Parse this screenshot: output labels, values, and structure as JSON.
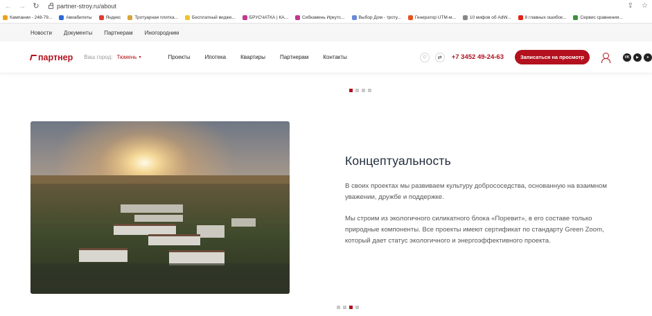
{
  "browser": {
    "url": "partner-stroy.ru/about",
    "bookmarks": [
      {
        "label": "Кампании - 248-79...",
        "color": "#e8a31b"
      },
      {
        "label": "Авиабилеты",
        "color": "#2b6ad8"
      },
      {
        "label": "Яндекс",
        "color": "#e33b2e"
      },
      {
        "label": "Тротуарная плитка...",
        "color": "#d6a63b"
      },
      {
        "label": "Бесплатный виджe...",
        "color": "#f2c12e"
      },
      {
        "label": "БРУСЧАТКА | КА...",
        "color": "#c2378f"
      },
      {
        "label": "Сибкамень Иркутс...",
        "color": "#c2378f"
      },
      {
        "label": "Выбор Дом - троту...",
        "color": "#6b8bd6"
      },
      {
        "label": "Генератор UTM-м...",
        "color": "#e8511c"
      },
      {
        "label": "10 мифов об AdW...",
        "color": "#888888"
      },
      {
        "label": "8 главных ошибок...",
        "color": "#e62117"
      },
      {
        "label": "Сервис сравнения...",
        "color": "#3f8f3f"
      }
    ]
  },
  "topbar": {
    "items": [
      "Новости",
      "Документы",
      "Партнерам",
      "Иногородним"
    ]
  },
  "header": {
    "logo": "партнер",
    "city_label": "Ваш город:",
    "city": "Тюмень",
    "nav": [
      "Проекты",
      "Ипотека",
      "Квартиры",
      "Партнерам",
      "Контакты"
    ],
    "phone": "+7 3452 49-24-63",
    "cta": "Записаться на просмотр",
    "socials": [
      "vk-icon",
      "youtube-icon",
      "telegram-icon"
    ]
  },
  "slider_top": {
    "count": 4,
    "active": 0
  },
  "slider_bottom": {
    "count": 4,
    "active": 2
  },
  "main": {
    "title": "Концептуальность",
    "paragraph1": "В своих проектах мы развиваем культуру добрососедства, основанную на взаимном уважении, дружбе и поддержке.",
    "paragraph2": "Мы строим из экологичного силикатного блока «Поревит», в его составе только природные компоненты. Все проекты имеют сертификат по стандарту Green Zoom, который дает статус экологичного и энергоэффективного проекта."
  },
  "colors": {
    "brand": "#b3111e"
  }
}
